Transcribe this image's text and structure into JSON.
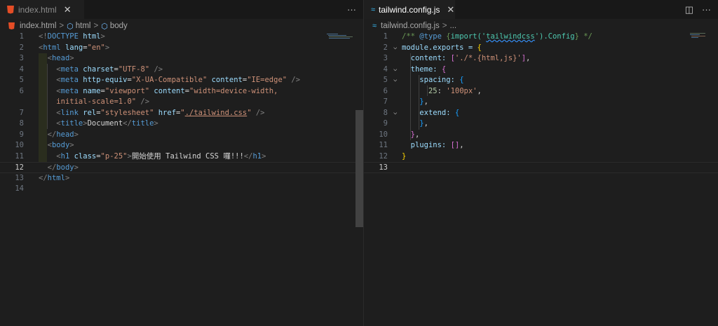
{
  "left": {
    "tab": {
      "label": "index.html",
      "close": "✕"
    },
    "more": "···",
    "breadcrumb": {
      "file": "index.html",
      "item1": "html",
      "item2": "body",
      "sep": ">"
    },
    "lines": [
      {
        "n": "1"
      },
      {
        "n": "2"
      },
      {
        "n": "3"
      },
      {
        "n": "4"
      },
      {
        "n": "5"
      },
      {
        "n": "6"
      },
      {
        "n": ""
      },
      {
        "n": "7"
      },
      {
        "n": "8"
      },
      {
        "n": "9"
      },
      {
        "n": "10"
      },
      {
        "n": "11"
      },
      {
        "n": "12"
      },
      {
        "n": "13"
      },
      {
        "n": "14"
      }
    ],
    "code": {
      "doctype_open": "<!",
      "doctype": "DOCTYPE",
      "doctype_html": "html",
      "close_angle": ">",
      "html_tag": "html",
      "lang_attr": "lang",
      "lang_val": "\"en\"",
      "head_tag": "head",
      "meta_tag": "meta",
      "charset_attr": "charset",
      "charset_val": "\"UTF-8\"",
      "self_close": "/>",
      "http_equiv_attr": "http-equiv",
      "http_equiv_val": "\"X-UA-Compatible\"",
      "content_attr": "content",
      "content_val1": "\"IE=edge\"",
      "name_attr": "name",
      "name_val": "\"viewport\"",
      "content_val2a": "\"width=device-width,",
      "content_val2b": "initial-scale=1.0\"",
      "link_tag": "link",
      "rel_attr": "rel",
      "rel_val": "\"stylesheet\"",
      "href_attr": "href",
      "href_q": "\"",
      "href_val": "./tailwind.css",
      "title_tag": "title",
      "title_text": "Document",
      "body_tag": "body",
      "h1_tag": "h1",
      "class_attr": "class",
      "class_val": "\"p-25\"",
      "h1_text": "開始使用 Tailwind CSS 囉!!!",
      "eq": "="
    }
  },
  "right": {
    "tab": {
      "label": "tailwind.config.js",
      "close": "✕"
    },
    "actions": {
      "split": "◫",
      "more": "···"
    },
    "breadcrumb": {
      "file": "tailwind.config.js",
      "sep": ">",
      "rest": "..."
    },
    "lines": [
      {
        "n": "1"
      },
      {
        "n": "2"
      },
      {
        "n": "3"
      },
      {
        "n": "4"
      },
      {
        "n": "5"
      },
      {
        "n": "6"
      },
      {
        "n": "7"
      },
      {
        "n": "8"
      },
      {
        "n": "9"
      },
      {
        "n": "10"
      },
      {
        "n": "11"
      },
      {
        "n": "12"
      },
      {
        "n": "13"
      }
    ],
    "code": {
      "c1a": "/** ",
      "c1b": "@type",
      "c1c": " {",
      "c1d": "import('",
      "c1e": "tailwindcss",
      "c1f": "').Config",
      "c1g": "} */",
      "l2a": "module.exports = ",
      "l2b": "{",
      "l3a": "content: ",
      "l3b": "[",
      "l3c": "'./*.{html,js}'",
      "l3d": "]",
      "l3e": ",",
      "l4a": "theme: ",
      "l4b": "{",
      "l5a": "spacing: ",
      "l5b": "{",
      "l6a": "25",
      "l6b": ": ",
      "l6c": "'100px'",
      "l6d": ",",
      "l7a": "}",
      "l7b": ",",
      "l8a": "extend: ",
      "l8b": "{",
      "l9a": "}",
      "l9b": ",",
      "l10a": "}",
      "l10b": ",",
      "l11a": "plugins: ",
      "l11b": "[]",
      "l11c": ",",
      "l12a": "}"
    }
  },
  "colors": {
    "html5": "#e44d26",
    "tailwind": "#38bdf8",
    "fold": "#c5c5c5"
  }
}
